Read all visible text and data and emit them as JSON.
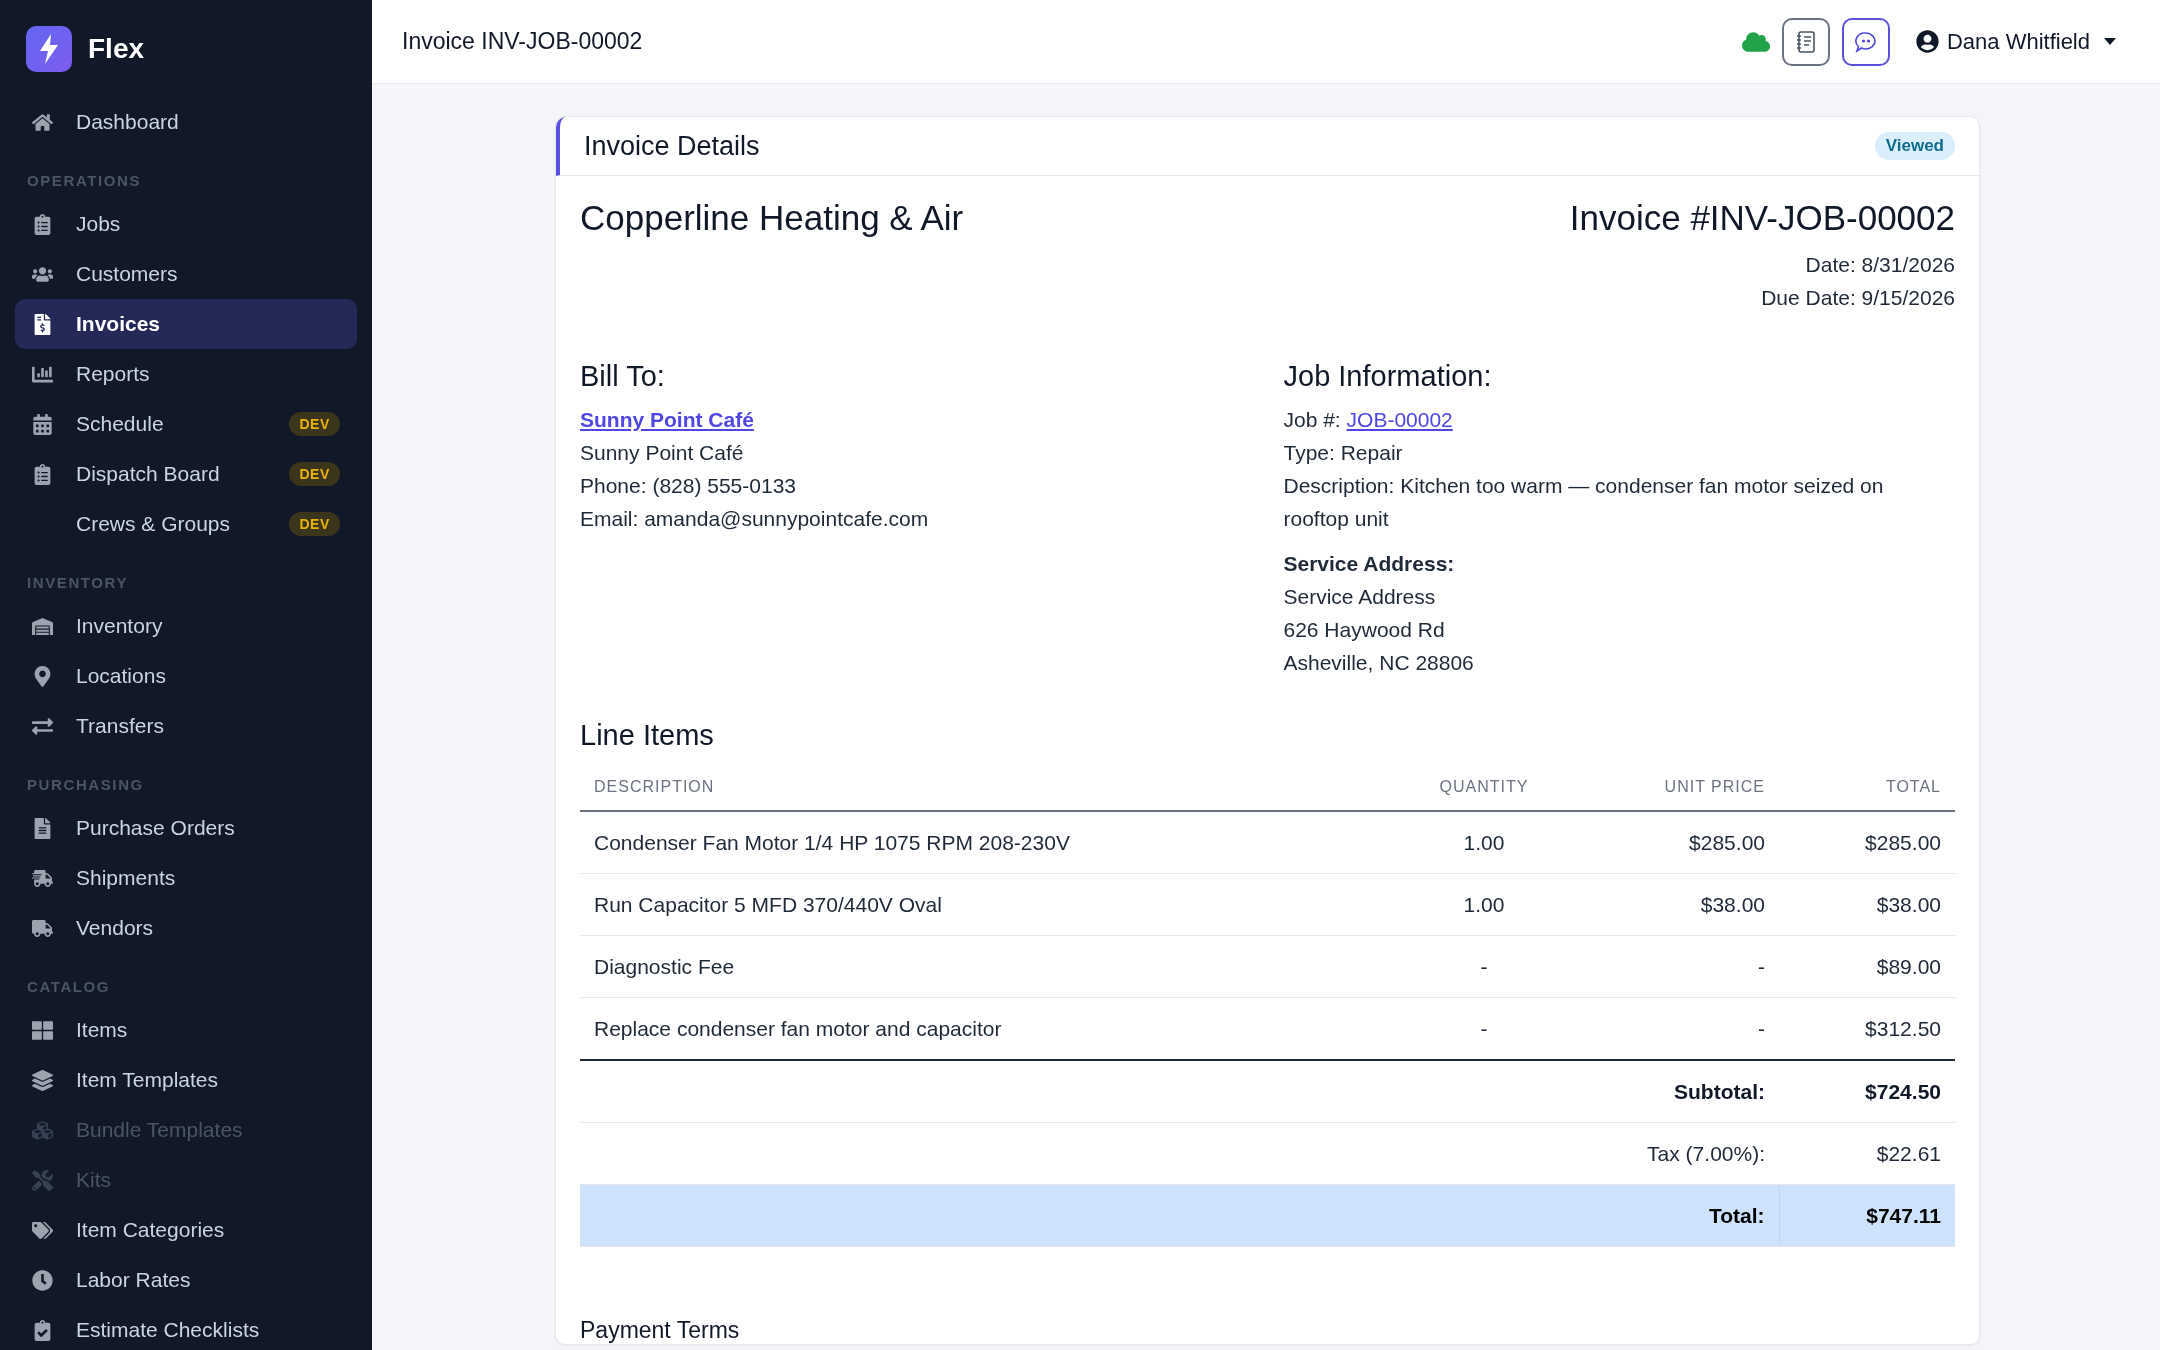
{
  "app": {
    "name": "Flex"
  },
  "sidebar": {
    "sections": [
      {
        "items": [
          {
            "label": "Dashboard",
            "selected": false,
            "disabled": false
          }
        ]
      },
      {
        "title": "OPERATIONS",
        "items": [
          {
            "label": "Jobs",
            "selected": false,
            "disabled": false
          },
          {
            "label": "Customers",
            "selected": false,
            "disabled": false
          },
          {
            "label": "Invoices",
            "selected": true,
            "disabled": false
          },
          {
            "label": "Reports",
            "selected": false,
            "disabled": false
          },
          {
            "label": "Schedule",
            "selected": false,
            "disabled": false,
            "badge": "DEV"
          },
          {
            "label": "Dispatch Board",
            "selected": false,
            "disabled": false,
            "badge": "DEV"
          },
          {
            "label": "Crews & Groups",
            "selected": false,
            "disabled": false,
            "badge": "DEV"
          }
        ]
      },
      {
        "title": "INVENTORY",
        "items": [
          {
            "label": "Inventory",
            "selected": false,
            "disabled": false
          },
          {
            "label": "Locations",
            "selected": false,
            "disabled": false
          },
          {
            "label": "Transfers",
            "selected": false,
            "disabled": false
          }
        ]
      },
      {
        "title": "PURCHASING",
        "items": [
          {
            "label": "Purchase Orders",
            "selected": false,
            "disabled": false
          },
          {
            "label": "Shipments",
            "selected": false,
            "disabled": false
          },
          {
            "label": "Vendors",
            "selected": false,
            "disabled": false
          }
        ]
      },
      {
        "title": "CATALOG",
        "items": [
          {
            "label": "Items",
            "selected": false,
            "disabled": false
          },
          {
            "label": "Item Templates",
            "selected": false,
            "disabled": false
          },
          {
            "label": "Bundle Templates",
            "selected": false,
            "disabled": true
          },
          {
            "label": "Kits",
            "selected": false,
            "disabled": true
          },
          {
            "label": "Item Categories",
            "selected": false,
            "disabled": false
          },
          {
            "label": "Labor Rates",
            "selected": false,
            "disabled": false
          },
          {
            "label": "Estimate Checklists",
            "selected": false,
            "disabled": false
          }
        ]
      }
    ]
  },
  "header": {
    "title": "Invoice INV-JOB-00002",
    "user": "Dana Whitfield"
  },
  "card": {
    "title": "Invoice Details",
    "status": "Viewed",
    "company": "Copperline Heating & Air",
    "invoice_number": "Invoice #INV-JOB-00002",
    "dates": [
      "Date: 8/31/2026",
      "Due Date: 9/15/2026"
    ],
    "bill_to": {
      "heading": "Bill To:",
      "customer_link": "Sunny Point Café",
      "lines": [
        "Sunny Point Café",
        "Phone: (828) 555-0133",
        "Email: amanda@sunnypointcafe.com"
      ]
    },
    "job_info": {
      "heading": "Job Information:",
      "job_label": "Job #: ",
      "job_link": "JOB-00002",
      "lines": [
        "Type: Repair",
        "Description: Kitchen too warm — condenser fan motor seized on rooftop unit"
      ],
      "address_heading": "Service Address:",
      "address_lines": [
        "Service Address",
        "626 Haywood Rd",
        "Asheville, NC 28806"
      ]
    },
    "line_items": {
      "heading": "Line Items",
      "columns": [
        "DESCRIPTION",
        "QUANTITY",
        "UNIT PRICE",
        "TOTAL"
      ],
      "rows": [
        [
          "Condenser Fan Motor 1/4 HP 1075 RPM 208-230V",
          "1.00",
          "$285.00",
          "$285.00"
        ],
        [
          "Run Capacitor 5 MFD 370/440V Oval",
          "1.00",
          "$38.00",
          "$38.00"
        ],
        [
          "Diagnostic Fee",
          "-",
          "-",
          "$89.00"
        ],
        [
          "Replace condenser fan motor and capacitor",
          "-",
          "-",
          "$312.50"
        ]
      ],
      "totals": [
        {
          "kind": "bold",
          "label": "Subtotal:",
          "value": "$724.50"
        },
        {
          "kind": "plain",
          "label": "Tax (7.00%):",
          "value": "$22.61"
        },
        {
          "kind": "highlight",
          "label": "Total:",
          "value": "$747.11"
        }
      ]
    },
    "payment_terms": {
      "heading": "Payment Terms"
    }
  }
}
